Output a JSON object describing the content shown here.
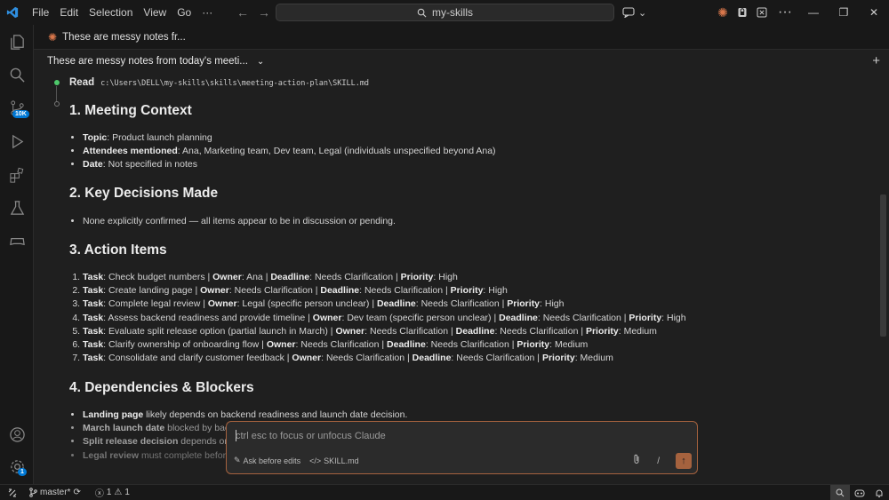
{
  "titlebar": {
    "menu": [
      "File",
      "Edit",
      "Selection",
      "View",
      "Go",
      "···"
    ],
    "search_text": "my-skills",
    "window_controls": [
      "minimize",
      "restore",
      "close"
    ]
  },
  "activity": {
    "source_control_badge": "10K",
    "settings_badge": "1"
  },
  "tab": {
    "label": "These are messy notes fr..."
  },
  "conversation": {
    "title": "These are messy notes from today's meeti..."
  },
  "read": {
    "label": "Read",
    "path": "c:\\Users\\DELL\\my-skills\\skills\\meeting-action-plan\\SKILL.md"
  },
  "sections": {
    "context": {
      "heading": "1. Meeting Context",
      "items": [
        {
          "k": "Topic",
          "v": ": Product launch planning"
        },
        {
          "k": "Attendees mentioned",
          "v": ": Ana, Marketing team, Dev team, Legal (individuals unspecified beyond Ana)"
        },
        {
          "k": "Date",
          "v": ": Not specified in notes"
        }
      ]
    },
    "decisions": {
      "heading": "2. Key Decisions Made",
      "items": [
        "None explicitly confirmed — all items appear to be in discussion or pending."
      ]
    },
    "actions": {
      "heading": "3. Action Items",
      "items": [
        {
          "task": "Check budget numbers",
          "owner": "Ana",
          "deadline": "Needs Clarification",
          "priority": "High"
        },
        {
          "task": "Create landing page",
          "owner": "Needs Clarification",
          "deadline": "Needs Clarification",
          "priority": "High"
        },
        {
          "task": "Complete legal review",
          "owner": "Legal (specific person unclear)",
          "deadline": "Needs Clarification",
          "priority": "High"
        },
        {
          "task": "Assess backend readiness and provide timeline",
          "owner": "Dev team (specific person unclear)",
          "deadline": "Needs Clarification",
          "priority": "High"
        },
        {
          "task": "Evaluate split release option (partial launch in March)",
          "owner": "Needs Clarification",
          "deadline": "Needs Clarification",
          "priority": "Medium"
        },
        {
          "task": "Clarify ownership of onboarding flow",
          "owner": "Needs Clarification",
          "deadline": "Needs Clarification",
          "priority": "Medium"
        },
        {
          "task": "Consolidate and clarify customer feedback",
          "owner": "Needs Clarification",
          "deadline": "Needs Clarification",
          "priority": "Medium"
        }
      ],
      "labels": {
        "task": "Task",
        "owner": "Owner",
        "deadline": "Deadline",
        "priority": "Priority"
      }
    },
    "dependencies": {
      "heading": "4. Dependencies & Blockers",
      "items": [
        {
          "k": "Landing page",
          "v": " likely depends on backend readiness and launch date decision."
        },
        {
          "k": "March launch date",
          "v": " blocked by back"
        },
        {
          "k": "Split release decision",
          "v": " depends on A"
        },
        {
          "k": "Legal review",
          "v": " must complete before"
        }
      ]
    }
  },
  "chat": {
    "placeholder": "ctrl esc to focus or unfocus Claude",
    "mode": "Ask before edits",
    "file": "SKILL.md",
    "slash": "/"
  },
  "statusbar": {
    "branch": "master*",
    "errors": "1",
    "warnings": "1"
  },
  "colors": {
    "accent": "#a5623e",
    "background": "#1f1f1f",
    "badge": "#0078d4",
    "success": "#4ec96b"
  }
}
